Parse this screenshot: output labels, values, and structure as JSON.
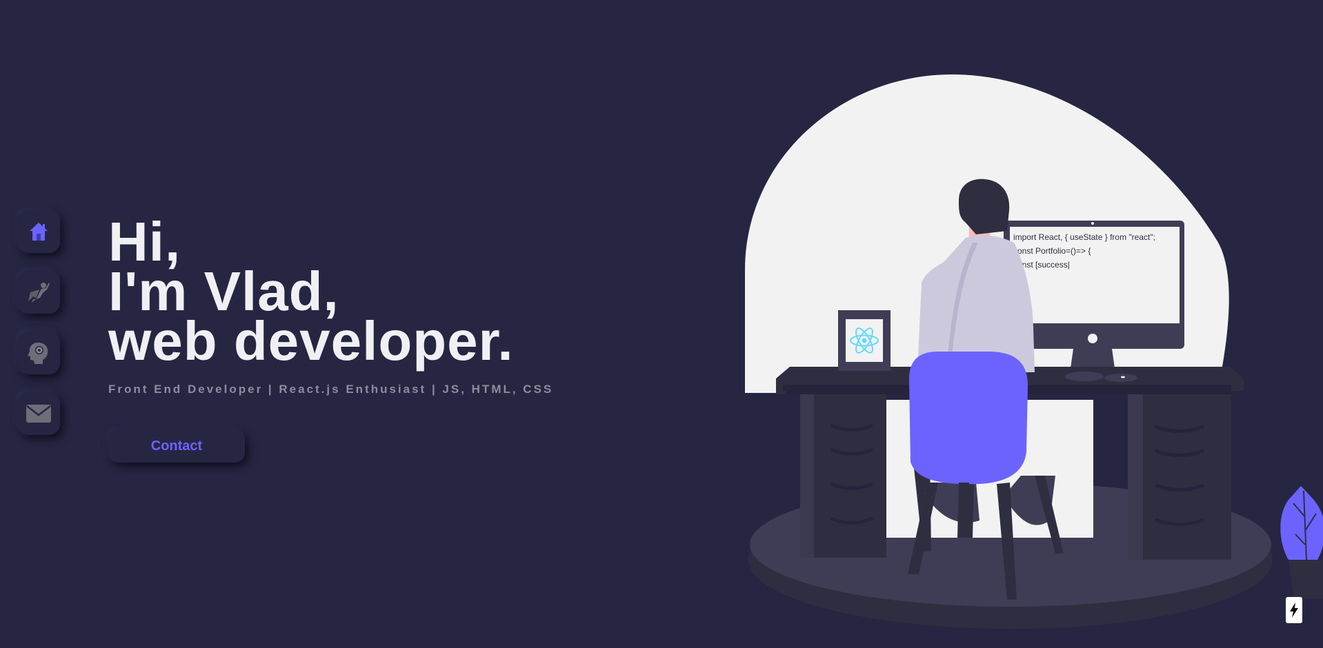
{
  "nav": {
    "items": [
      {
        "name": "home",
        "icon": "home-icon",
        "active": true
      },
      {
        "name": "projects",
        "icon": "superhero-icon",
        "active": false
      },
      {
        "name": "skills",
        "icon": "head-gear-icon",
        "active": false
      },
      {
        "name": "contact",
        "icon": "envelope-icon",
        "active": false
      }
    ]
  },
  "hero": {
    "line1": "Hi,",
    "line2": "I'm Vlad,",
    "line3": "web developer.",
    "subtitle": "Front End Developer | React.js Enthusiast | JS, HTML, CSS"
  },
  "contact_button": {
    "label": "Contact"
  },
  "illustration": {
    "code_lines": [
      "import React, { useState } from \"react\";",
      "const Portfolio=()=> {",
      "const [success|"
    ],
    "frame_icon": "react-logo-icon"
  },
  "colors": {
    "background": "#262643",
    "accent": "#6c63ff",
    "heading": "#f0f0f4",
    "subtitle": "#8e8c99"
  }
}
